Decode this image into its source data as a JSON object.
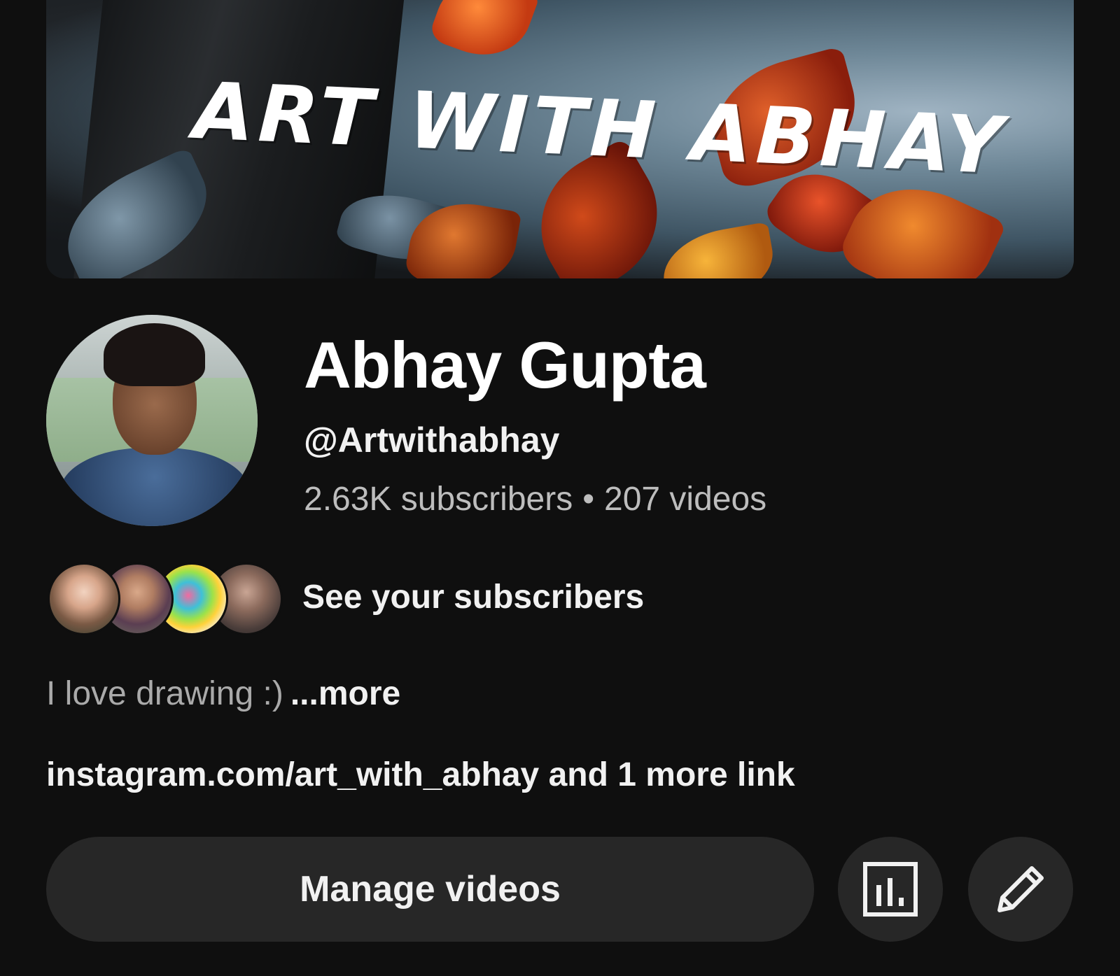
{
  "banner": {
    "title": "ART WITH ABHAY"
  },
  "channel": {
    "name": "Abhay Gupta",
    "handle": "@Artwithabhay",
    "subscribers": "2.63K subscribers",
    "separator": "•",
    "videos": "207 videos"
  },
  "subscribers_row": {
    "label": "See your subscribers"
  },
  "description": {
    "text": "I love drawing :)",
    "more_label": "...more"
  },
  "links": {
    "text": "instagram.com/art_with_abhay and 1 more link"
  },
  "actions": {
    "manage_videos_label": "Manage videos",
    "analytics_icon": "analytics-icon",
    "edit_icon": "edit-pencil-icon"
  },
  "colors": {
    "background": "#0f0f0f",
    "button_bg": "#272727",
    "primary_text": "#f1f1f1",
    "secondary_text": "#aaaaaa"
  }
}
